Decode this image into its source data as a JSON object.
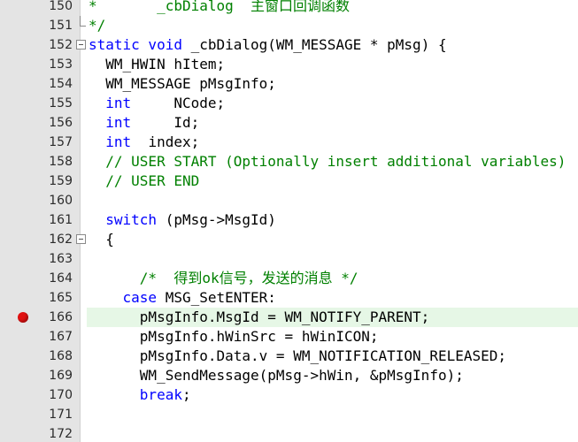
{
  "editor": {
    "lines": [
      {
        "num": "150",
        "text": "*       _cbDialog  主窗口回调函数",
        "kind": "comment"
      },
      {
        "num": "151",
        "text": "*/",
        "kind": "comment"
      },
      {
        "num": "152",
        "kw": "static void",
        "text": " _cbDialog(WM_MESSAGE * pMsg) {",
        "kind": "kwline"
      },
      {
        "num": "153",
        "text": "  WM_HWIN hItem;",
        "kind": "plain"
      },
      {
        "num": "154",
        "text": "  WM_MESSAGE pMsgInfo;",
        "kind": "plain"
      },
      {
        "num": "155",
        "indent": "  ",
        "kw": "int",
        "text": "     NCode;",
        "kind": "kwline"
      },
      {
        "num": "156",
        "indent": "  ",
        "kw": "int",
        "text": "     Id;",
        "kind": "kwline"
      },
      {
        "num": "157",
        "indent": "  ",
        "kw": "int",
        "text": "  index;",
        "kind": "kwline"
      },
      {
        "num": "158",
        "text": "  // USER START (Optionally insert additional variables)",
        "kind": "comment"
      },
      {
        "num": "159",
        "text": "  // USER END",
        "kind": "comment"
      },
      {
        "num": "160",
        "text": "",
        "kind": "plain"
      },
      {
        "num": "161",
        "indent": "  ",
        "kw": "switch",
        "text": " (pMsg->MsgId)",
        "kind": "kwline"
      },
      {
        "num": "162",
        "text": "  {",
        "kind": "plain"
      },
      {
        "num": "163",
        "text": "",
        "kind": "plain"
      },
      {
        "num": "164",
        "text": "      /*  得到ok信号，发送的消息 */",
        "kind": "comment"
      },
      {
        "num": "165",
        "indent": "    ",
        "kw": "case",
        "text": " MSG_SetENTER:",
        "kind": "kwline"
      },
      {
        "num": "166",
        "text": "      pMsgInfo.MsgId = WM_NOTIFY_PARENT;",
        "kind": "plain"
      },
      {
        "num": "167",
        "text": "      pMsgInfo.hWinSrc = hWinICON;",
        "kind": "plain"
      },
      {
        "num": "168",
        "text": "      pMsgInfo.Data.v = WM_NOTIFICATION_RELEASED;",
        "kind": "plain"
      },
      {
        "num": "169",
        "text": "      WM_SendMessage(pMsg->hWin, &pMsgInfo);",
        "kind": "plain"
      },
      {
        "num": "170",
        "indent": "      ",
        "kw": "break",
        "text": ";",
        "kind": "kwline"
      },
      {
        "num": "171",
        "text": "",
        "kind": "plain"
      },
      {
        "num": "172",
        "text": "",
        "kind": "plain"
      }
    ],
    "breakpoint_line": "166",
    "highlighted_line": "166",
    "fold_open_lines": [
      "152",
      "162"
    ],
    "fold_end_lines": [
      "151"
    ],
    "colors": {
      "keyword": "#0000ff",
      "comment": "#008000",
      "breakpoint": "#e01010",
      "current_line": "#e6f7e6"
    }
  }
}
